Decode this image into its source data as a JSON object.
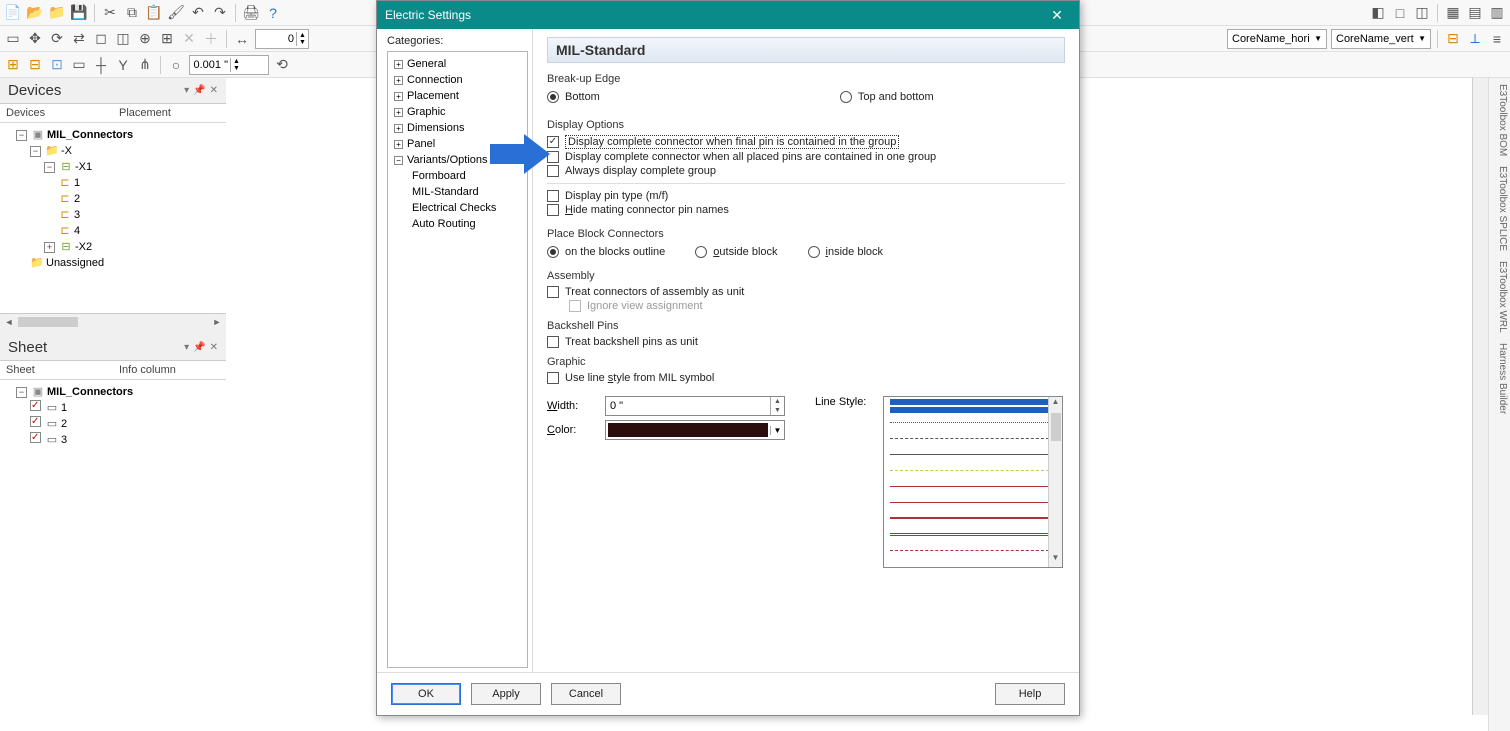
{
  "toolbar": {
    "spin1": "0",
    "grid_value": "0.001 \"",
    "combo_hori": "CoreName_hori",
    "combo_vert": "CoreName_vert"
  },
  "devices_panel": {
    "title": "Devices",
    "col1": "Devices",
    "col2": "Placement",
    "tree": {
      "root": "MIL_Connectors",
      "x_folder": "-X",
      "x1": "-X1",
      "pin1": "1",
      "pin2": "2",
      "pin3": "3",
      "pin4": "4",
      "x2": "-X2",
      "unassigned": "Unassigned"
    }
  },
  "sheet_panel": {
    "title": "Sheet",
    "col1": "Sheet",
    "col2": "Info column",
    "root": "MIL_Connectors",
    "s1": "1",
    "s2": "2",
    "s3": "3"
  },
  "right_tabs": {
    "t1": "E3Toolbox BOM",
    "t2": "E3Toolbox SPLICE",
    "t3": "E3Toolbox WRL",
    "t4": "Harness Builder"
  },
  "dialog": {
    "title": "Electric Settings",
    "cat_label": "Categories:",
    "categories": {
      "general": "General",
      "connection": "Connection",
      "placement": "Placement",
      "graphic": "Graphic",
      "dimensions": "Dimensions",
      "panel": "Panel",
      "variants": "Variants/Options",
      "formboard": "Formboard",
      "mil": "MIL-Standard",
      "checks": "Electrical Checks",
      "routing": "Auto Routing"
    },
    "heading": "MIL-Standard",
    "breakup": {
      "label": "Break-up Edge",
      "bottom": "Bottom",
      "topbottom": "Top and bottom"
    },
    "display_options": {
      "label": "Display Options",
      "cb1": "Display complete connector when final pin is contained in the group",
      "cb2": "Display complete connector when all placed pins are contained in one group",
      "cb3": "Always display complete group",
      "cb4": "Display pin type (m/f)",
      "cb5": "Hide mating connector pin names"
    },
    "place_block": {
      "label": "Place Block Connectors",
      "r1": "on the blocks outline",
      "r2": "outside block",
      "r3": "inside block"
    },
    "assembly": {
      "label": "Assembly",
      "cb1": "Treat connectors of assembly as unit",
      "cb2": "Ignore view assignment"
    },
    "backshell": {
      "label": "Backshell Pins",
      "cb1": "Treat backshell pins as unit"
    },
    "graphic": {
      "label": "Graphic",
      "cb1": "Use line style from MIL symbol",
      "width_label": "Width:",
      "width_value": "0 \"",
      "color_label": "Color:",
      "linestyle_label": "Line Style:"
    },
    "buttons": {
      "ok": "OK",
      "apply": "Apply",
      "cancel": "Cancel",
      "help": "Help"
    }
  }
}
